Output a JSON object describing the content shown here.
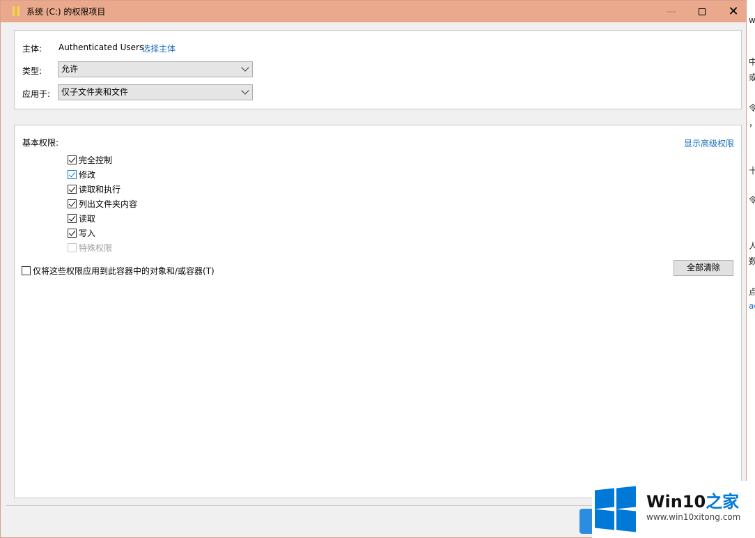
{
  "window": {
    "title": "系统 (C:) 的权限项目",
    "minimize_glyph": "—",
    "close_glyph": "✕"
  },
  "principal": {
    "label": "主体:",
    "value": "Authenticated Users",
    "link": "选择主体"
  },
  "type": {
    "label": "类型:",
    "value": "允许"
  },
  "applies_to": {
    "label": "应用于:",
    "value": "仅子文件夹和文件"
  },
  "basic_permissions": {
    "label": "基本权限:",
    "show_advanced_link": "显示高级权限",
    "items": [
      {
        "label": "完全控制",
        "checked": true,
        "focused": false,
        "disabled": false
      },
      {
        "label": "修改",
        "checked": true,
        "focused": true,
        "disabled": false
      },
      {
        "label": "读取和执行",
        "checked": true,
        "focused": false,
        "disabled": false
      },
      {
        "label": "列出文件夹内容",
        "checked": true,
        "focused": false,
        "disabled": false
      },
      {
        "label": "读取",
        "checked": true,
        "focused": false,
        "disabled": false
      },
      {
        "label": "写入",
        "checked": true,
        "focused": false,
        "disabled": false
      },
      {
        "label": "特殊权限",
        "checked": false,
        "focused": false,
        "disabled": true
      }
    ]
  },
  "apply_to_container": {
    "label": "仅将这些权限应用到此容器中的对象和/或容器(T)",
    "checked": false
  },
  "clear_all_button": "全部清除",
  "watermark": {
    "name_prefix": "Win10",
    "name_suffix": "之家",
    "url": "www.win10xitong.com"
  },
  "background_window_fragments": [
    "wi",
    "中",
    "或",
    "令",
    "，",
    "十",
    "令",
    "人自",
    "数",
    "点",
    "ac"
  ]
}
